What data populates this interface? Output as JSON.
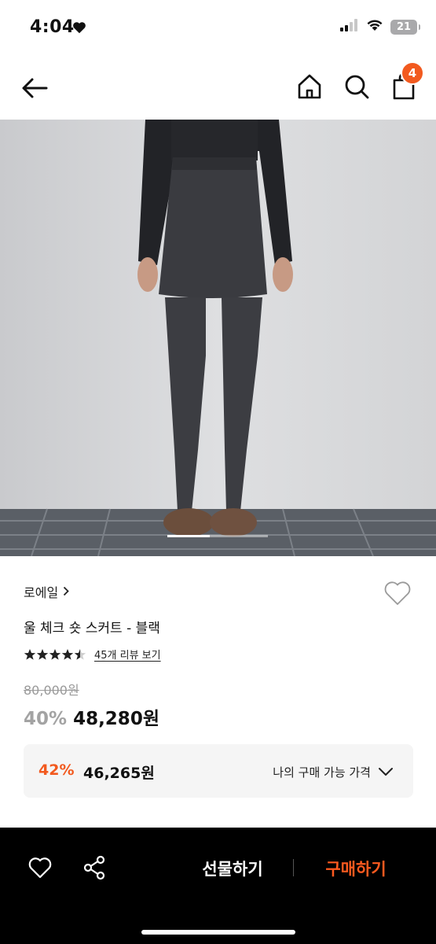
{
  "status_bar": {
    "time": "4:04",
    "battery": "21"
  },
  "nav": {
    "cart_count": "4"
  },
  "product": {
    "brand": "로에일",
    "title": "울 체크 숏 스커트 - 블랙",
    "rating": 4.5,
    "review_link": "45개 리뷰 보기",
    "original_price": "80,000원",
    "discount": "40%",
    "sale_price": "48,280원",
    "image_progress": 0.42
  },
  "member_price": {
    "discount": "42%",
    "price": "46,265원",
    "label": "나의 구매 가능 가격"
  },
  "bottom_bar": {
    "gift_label": "선물하기",
    "buy_label": "구매하기"
  },
  "colors": {
    "accent": "#f25a1f",
    "buy_text": "#ff5a1f",
    "bottom_bar_bg": "#000000",
    "member_box_bg": "#f5f5f5"
  }
}
